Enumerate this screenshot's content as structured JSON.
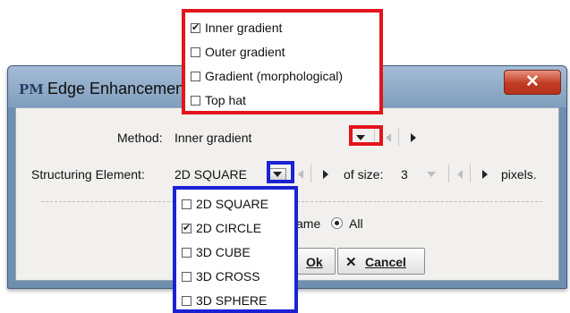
{
  "window": {
    "title": "Edge Enhancement",
    "close_glyph": "✕"
  },
  "app_icon": "PM",
  "method": {
    "label": "Method:",
    "value": "Inner gradient"
  },
  "structuring_element": {
    "label": "Structuring Element:",
    "value": "2D SQUARE",
    "size_label": "of size:",
    "size_value": "3",
    "unit_label": "pixels."
  },
  "scope": {
    "frame_fragment": "ame",
    "all_label": "All"
  },
  "buttons": {
    "ok_label": "Ok",
    "cancel_label": "Cancel",
    "cancel_glyph": "✕"
  },
  "method_menu": {
    "items": [
      {
        "label": "Inner gradient",
        "checked": true
      },
      {
        "label": "Outer gradient",
        "checked": false
      },
      {
        "label": "Gradient (morphological)",
        "checked": false
      },
      {
        "label": "Top hat",
        "checked": false
      }
    ]
  },
  "structure_menu": {
    "items": [
      {
        "label": "2D SQUARE",
        "checked": false
      },
      {
        "label": "2D CIRCLE",
        "checked": true
      },
      {
        "label": "3D CUBE",
        "checked": false
      },
      {
        "label": "3D CROSS",
        "checked": false
      },
      {
        "label": "3D SPHERE",
        "checked": false
      }
    ]
  },
  "colors": {
    "red_highlight": "#e3141b",
    "blue_highlight": "#1a22d4",
    "title_bar": "#8faed0",
    "close_button": "#c13b22"
  }
}
